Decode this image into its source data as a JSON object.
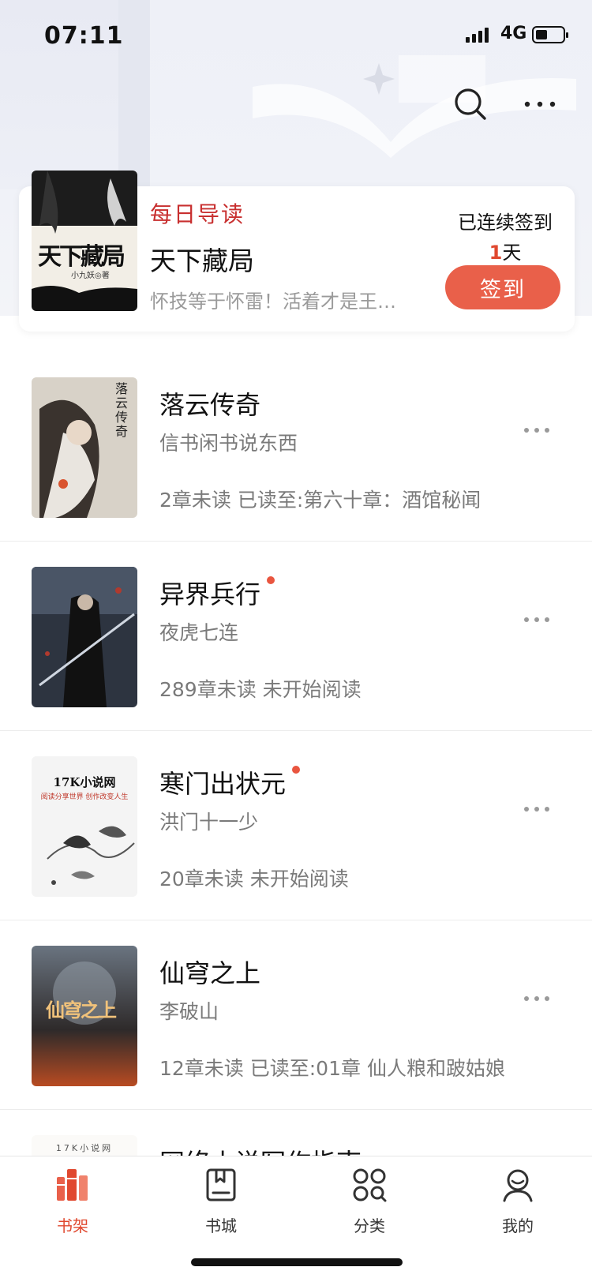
{
  "status_bar": {
    "time": "07:11",
    "network": "4G"
  },
  "header": {
    "search_icon": "search-icon",
    "more_icon": "more-icon"
  },
  "daily": {
    "tag": "每日导读",
    "book_title": "天下藏局",
    "description": "怀技等于怀雷！活着才是王…",
    "cover_title": "天下藏局",
    "cover_author": "小九妖◎著",
    "checkin_label": "已连续签到",
    "checkin_days": "1",
    "checkin_unit": "天",
    "checkin_button": "签到"
  },
  "books": [
    {
      "title": "落云传奇",
      "author": "信书闲书说东西",
      "status": "2章未读 已读至:第六十章：酒馆秘闻",
      "has_update": false,
      "cover_text": "落云传奇"
    },
    {
      "title": "异界兵行",
      "author": "夜虎七连",
      "status": "289章未读 未开始阅读",
      "has_update": true,
      "cover_text": ""
    },
    {
      "title": "寒门出状元",
      "author": "洪门十一少",
      "status": "20章未读 未开始阅读",
      "has_update": true,
      "cover_text": "17K小说网",
      "cover_sub": "阅读分享世界 创作改变人生"
    },
    {
      "title": "仙穹之上",
      "author": "李破山",
      "status": "12章未读 已读至:01章 仙人粮和跛姑娘",
      "has_update": false,
      "cover_text": "仙穹之上"
    },
    {
      "title": "网络小说写作指南",
      "author": "",
      "status": "",
      "has_update": false,
      "cover_text": "17K小说网"
    }
  ],
  "tabs": [
    {
      "label": "书架",
      "icon": "bookshelf-icon",
      "active": true
    },
    {
      "label": "书城",
      "icon": "bookstore-icon",
      "active": false
    },
    {
      "label": "分类",
      "icon": "category-icon",
      "active": false
    },
    {
      "label": "我的",
      "icon": "profile-icon",
      "active": false
    }
  ],
  "colors": {
    "accent": "#e9604a",
    "tag_red": "#c82f2f",
    "text_gray": "#7a7a7a"
  }
}
